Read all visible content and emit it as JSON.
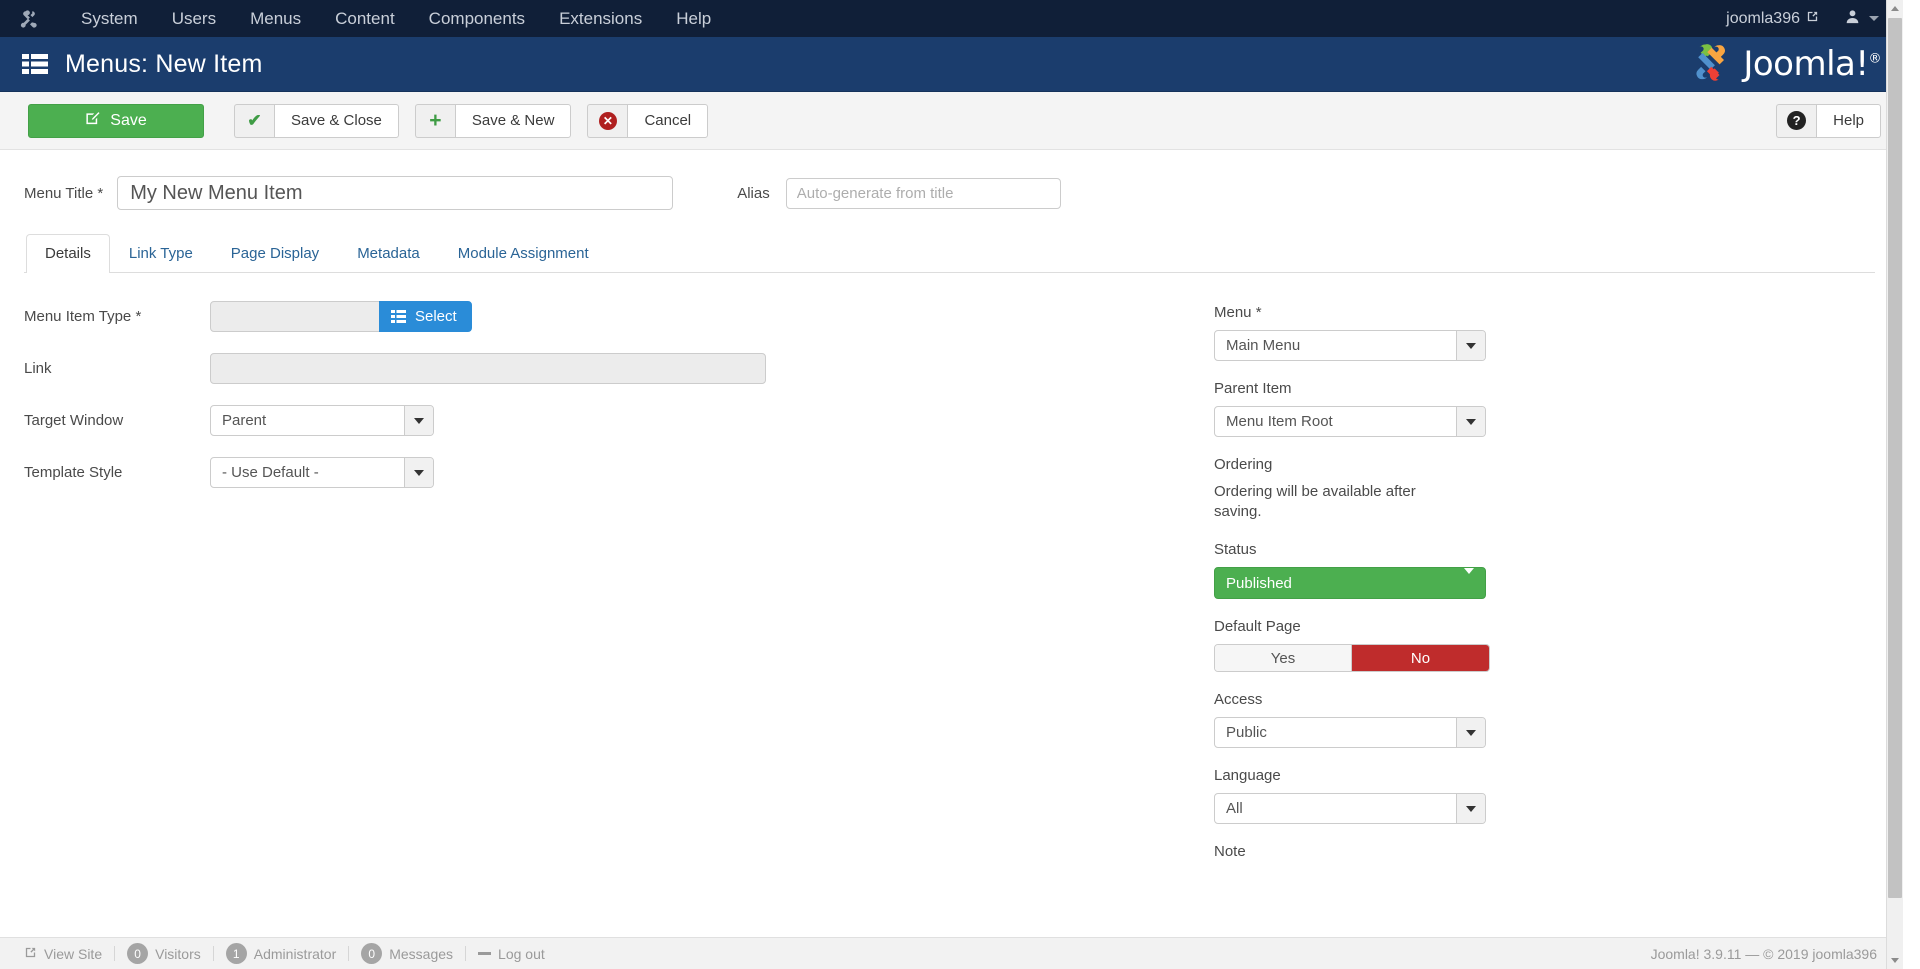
{
  "topbar": {
    "logo_icon": "joomla-mark-icon",
    "nav": [
      {
        "label": "System",
        "name": "system"
      },
      {
        "label": "Users",
        "name": "users"
      },
      {
        "label": "Menus",
        "name": "menus"
      },
      {
        "label": "Content",
        "name": "content"
      },
      {
        "label": "Components",
        "name": "components"
      },
      {
        "label": "Extensions",
        "name": "extensions"
      },
      {
        "label": "Help",
        "name": "help"
      }
    ],
    "site_name": "joomla396",
    "site_link_icon": "external-link-icon",
    "user_icon": "user-icon",
    "user_caret_icon": "chevron-down-icon"
  },
  "header": {
    "icon": "list-icon",
    "title": "Menus: New Item",
    "brand": "Joomla!",
    "brand_reg": "®",
    "brand_icon": "joomla-pinwheel-icon"
  },
  "toolbar": {
    "save_label": "Save",
    "save_icon": "pencil-square-icon",
    "save_close_label": "Save & Close",
    "save_close_icon": "check-icon",
    "save_new_label": "Save & New",
    "save_new_icon": "plus-icon",
    "cancel_label": "Cancel",
    "cancel_icon": "circle-x-icon",
    "help_label": "Help",
    "help_icon": "question-circle-icon"
  },
  "form": {
    "menu_title_label": "Menu Title",
    "menu_title_required": "*",
    "menu_title_value": "My New Menu Item",
    "alias_label": "Alias",
    "alias_value": "",
    "alias_placeholder": "Auto-generate from title"
  },
  "tabs": [
    {
      "label": "Details",
      "active": true
    },
    {
      "label": "Link Type",
      "active": false
    },
    {
      "label": "Page Display",
      "active": false
    },
    {
      "label": "Metadata",
      "active": false
    },
    {
      "label": "Module Assignment",
      "active": false
    }
  ],
  "details": {
    "menu_item_type_label": "Menu Item Type",
    "menu_item_type_required": "*",
    "menu_item_type_value": "",
    "select_button_label": "Select",
    "select_button_icon": "list-icon",
    "link_label": "Link",
    "link_value": "",
    "target_window_label": "Target Window",
    "target_window_value": "Parent",
    "template_style_label": "Template Style",
    "template_style_value": "- Use Default -"
  },
  "sidebar": {
    "menu_label": "Menu",
    "menu_required": "*",
    "menu_value": "Main Menu",
    "parent_item_label": "Parent Item",
    "parent_item_value": "Menu Item Root",
    "ordering_label": "Ordering",
    "ordering_text": "Ordering will be available after saving.",
    "status_label": "Status",
    "status_value": "Published",
    "status_color": "#4caf50",
    "default_page_label": "Default Page",
    "default_page_yes": "Yes",
    "default_page_no": "No",
    "default_page_selected": "No",
    "default_page_no_color": "#bf2c2c",
    "access_label": "Access",
    "access_value": "Public",
    "language_label": "Language",
    "language_value": "All",
    "note_label": "Note"
  },
  "statusbar": {
    "view_site_label": "View Site",
    "view_site_icon": "external-link-icon",
    "visitors_count": "0",
    "visitors_label": "Visitors",
    "administrator_count": "1",
    "administrator_label": "Administrator",
    "messages_count": "0",
    "messages_label": "Messages",
    "logout_label": "Log out",
    "logout_icon": "minus-icon",
    "copyright": "Joomla! 3.9.11  —  © 2019 joomla396"
  }
}
